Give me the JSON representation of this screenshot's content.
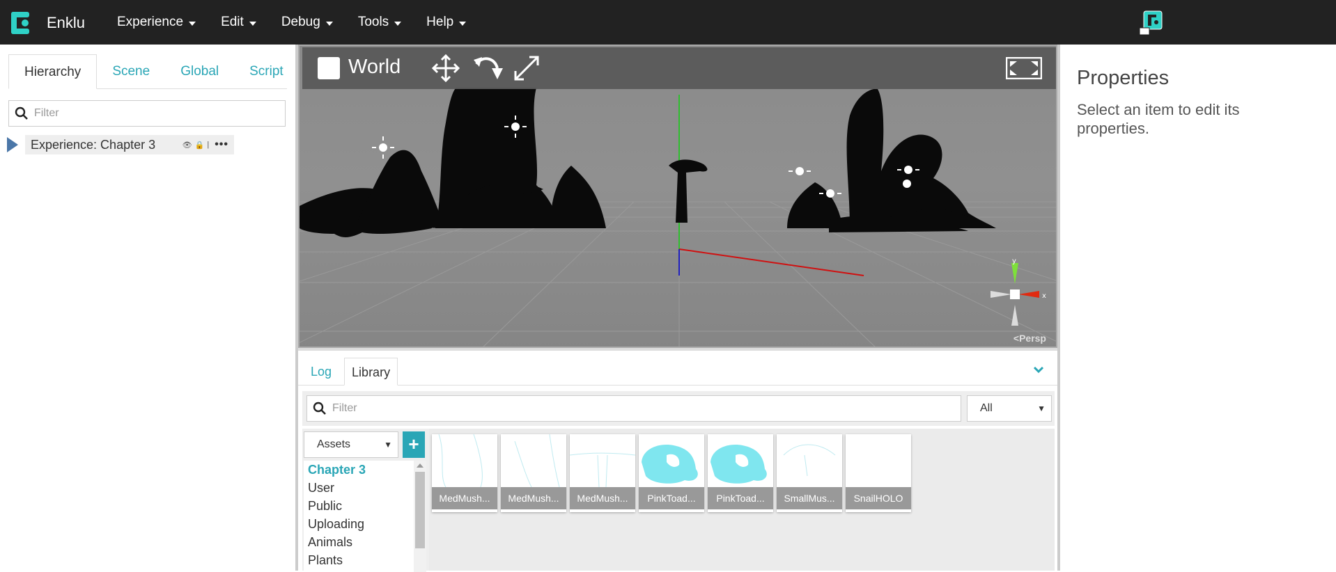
{
  "app": {
    "name": "Enklu",
    "brand_color": "#2fd1c6"
  },
  "menu": [
    {
      "label": "Experience"
    },
    {
      "label": "Edit"
    },
    {
      "label": "Debug"
    },
    {
      "label": "Tools"
    },
    {
      "label": "Help"
    }
  ],
  "left_panel": {
    "tabs": [
      {
        "label": "Hierarchy",
        "active": true
      },
      {
        "label": "Scene"
      },
      {
        "label": "Global"
      },
      {
        "label": "Script"
      }
    ],
    "filter_placeholder": "Filter",
    "tree": {
      "label": "Experience: Chapter 3",
      "more": "•••"
    }
  },
  "viewport": {
    "world_label": "World",
    "persp_label": "Persp",
    "tools": [
      "move-icon",
      "rotate-icon",
      "scale-icon"
    ],
    "gizmo_labels": {
      "y": "y",
      "x": "x"
    }
  },
  "bottom": {
    "tabs": [
      {
        "label": "Log"
      },
      {
        "label": "Library",
        "active": true
      }
    ],
    "filter_placeholder": "Filter",
    "filter_select": "All",
    "source_select": "Assets",
    "add_label": "+",
    "folders": [
      {
        "label": "Chapter 3",
        "active": true
      },
      {
        "label": "User"
      },
      {
        "label": "Public"
      },
      {
        "label": "Uploading"
      },
      {
        "label": "Animals"
      },
      {
        "label": "Plants"
      }
    ],
    "assets": [
      {
        "label": "MedMush..."
      },
      {
        "label": "MedMush..."
      },
      {
        "label": "MedMush..."
      },
      {
        "label": "PinkToad..."
      },
      {
        "label": "PinkToad..."
      },
      {
        "label": "SmallMus..."
      },
      {
        "label": "SnailHOLO"
      }
    ]
  },
  "properties": {
    "title": "Properties",
    "hint": "Select an item to edit its properties."
  },
  "colors": {
    "accent": "#2aa6b6",
    "topbar": "#222222"
  }
}
